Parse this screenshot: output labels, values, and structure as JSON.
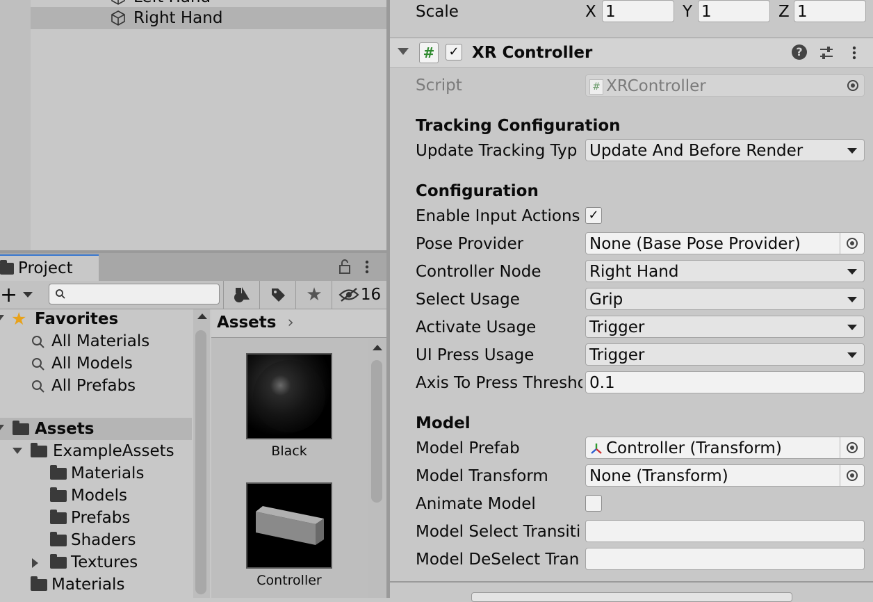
{
  "hierarchy": {
    "items": [
      {
        "label": "Left Hand"
      },
      {
        "label": "Right Hand",
        "selected": true
      }
    ]
  },
  "project": {
    "tab_label": "Project",
    "hidden_count": "16",
    "search_placeholder": "",
    "tree": {
      "favorites_label": "Favorites",
      "favorites": [
        "All Materials",
        "All Models",
        "All Prefabs"
      ],
      "assets_label": "Assets",
      "example_assets_label": "ExampleAssets",
      "example_children": [
        "Materials",
        "Models",
        "Prefabs",
        "Shaders",
        "Textures"
      ],
      "materials_label": "Materials"
    },
    "breadcrumb": "Assets",
    "grid": [
      {
        "label": "Black"
      },
      {
        "label": "Controller"
      }
    ]
  },
  "inspector": {
    "scale_label": "Scale",
    "scale": {
      "x_label": "X",
      "x": "1",
      "y_label": "Y",
      "y": "1",
      "z_label": "Z",
      "z": "1"
    },
    "component": {
      "title": "XR Controller",
      "enabled": true,
      "script_label": "Script",
      "script_value": "XRController"
    },
    "tracking_header": "Tracking Configuration",
    "update_tracking_label": "Update Tracking Typ",
    "update_tracking_value": "Update And Before Render",
    "config_header": "Configuration",
    "enable_input_label": "Enable Input Actions",
    "enable_input_checked": true,
    "pose_provider_label": "Pose Provider",
    "pose_provider_value": "None (Base Pose Provider)",
    "controller_node_label": "Controller Node",
    "controller_node_value": "Right Hand",
    "select_usage_label": "Select Usage",
    "select_usage_value": "Grip",
    "activate_usage_label": "Activate Usage",
    "activate_usage_value": "Trigger",
    "ui_press_label": "UI Press Usage",
    "ui_press_value": "Trigger",
    "axis_label": "Axis To Press Thresho",
    "axis_value": "0.1",
    "model_header": "Model",
    "model_prefab_label": "Model Prefab",
    "model_prefab_value": "Controller (Transform)",
    "model_transform_label": "Model Transform",
    "model_transform_value": "None (Transform)",
    "animate_model_label": "Animate Model",
    "animate_model_checked": false,
    "model_select_label": "Model Select Transiti",
    "model_select_value": "",
    "model_deselect_label": "Model DeSelect Tran",
    "model_deselect_value": ""
  }
}
